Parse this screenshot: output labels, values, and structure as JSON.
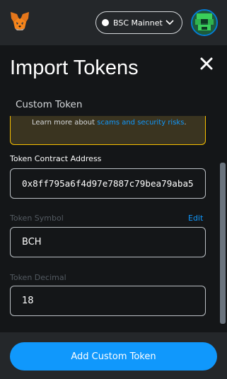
{
  "network": {
    "name": "BSC Mainnet"
  },
  "page": {
    "title": "Import Tokens"
  },
  "tabs": {
    "custom_token": "Custom Token"
  },
  "warning": {
    "text": "Learn more about ",
    "link": "scams and security risks",
    "end": "."
  },
  "fields": {
    "contract_address": {
      "label": "Token Contract Address",
      "value": "0x8ff795a6f4d97e7887c79bea79aba5"
    },
    "symbol": {
      "label": "Token Symbol",
      "edit": "Edit",
      "value": "BCH"
    },
    "decimal": {
      "label": "Token Decimal",
      "value": "18"
    }
  },
  "footer": {
    "add_button": "Add Custom Token"
  },
  "colors": {
    "accent": "#1098fc",
    "warning_border": "#f8c000",
    "background": "#141618"
  },
  "icons": [
    "metamask-fox-icon",
    "chevron-down-icon",
    "account-avatar",
    "close-icon"
  ]
}
